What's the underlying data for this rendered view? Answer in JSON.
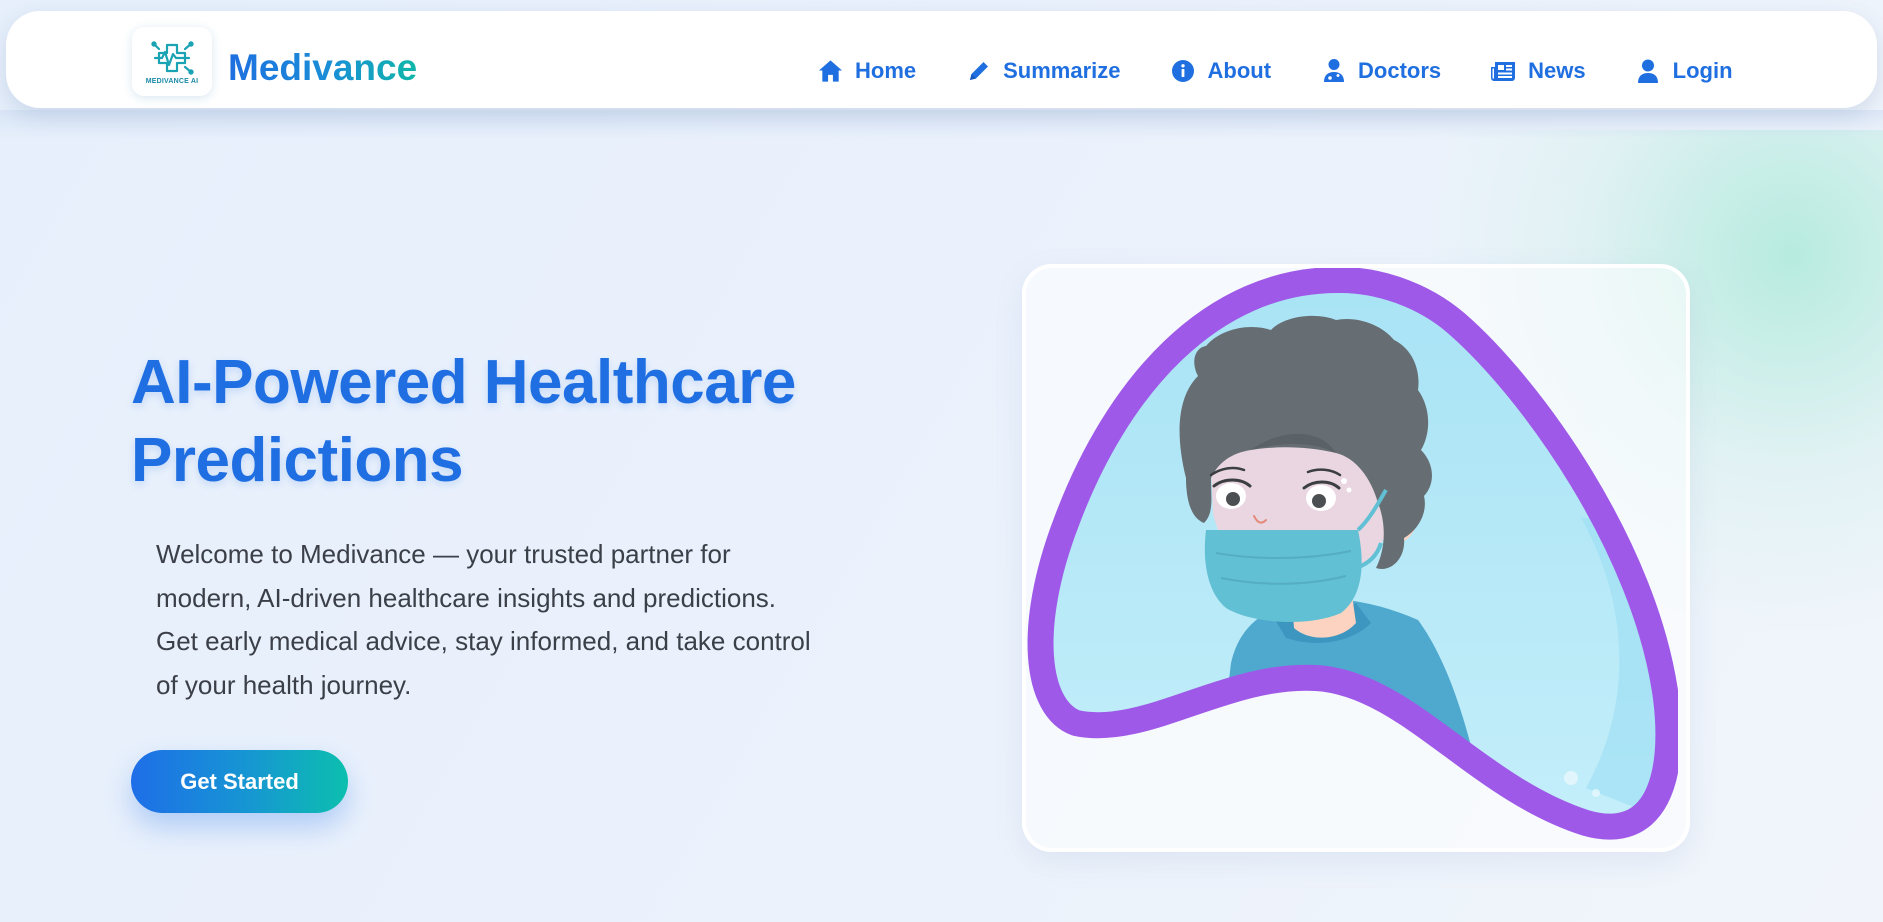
{
  "brand": {
    "name": "Medivance",
    "logo_caption": "MEDIVANCE AI",
    "logo_icon": "medical-chip-icon"
  },
  "nav": {
    "items": [
      {
        "label": "Home",
        "icon": "home-icon"
      },
      {
        "label": "Summarize",
        "icon": "pencil-icon"
      },
      {
        "label": "About",
        "icon": "info-icon"
      },
      {
        "label": "Doctors",
        "icon": "doctor-icon"
      },
      {
        "label": "News",
        "icon": "newspaper-icon"
      },
      {
        "label": "Login",
        "icon": "user-icon"
      }
    ]
  },
  "hero": {
    "title_line1": "AI-Powered Healthcare",
    "title_line2": "Predictions",
    "description_lines": [
      "Welcome to Medivance — your trusted partner for",
      "modern, AI-driven healthcare insights and predictions.",
      "Get early medical advice, stay informed, and take control",
      "of your health journey."
    ],
    "cta_label": "Get Started",
    "illustration": "sick-masked-person-illustration"
  },
  "colors": {
    "primary": "#1f6fe0",
    "accent": "#0fb7a8",
    "blob_purple": "#9f59e8",
    "blob_fill": "#b8e8f7",
    "text_dark": "#3b3f48"
  }
}
